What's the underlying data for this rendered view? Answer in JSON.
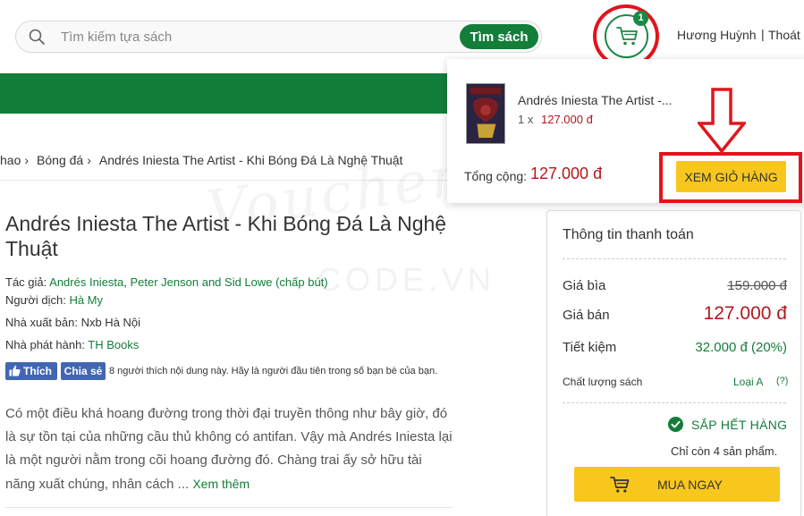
{
  "header": {
    "search_placeholder": "Tìm kiếm tựa sách",
    "search_button": "Tìm sách",
    "cart_count": "1",
    "user_name": "Hương Huỳnh",
    "separator": "|",
    "logout": "Thoát"
  },
  "breadcrumb": [
    {
      "label": "hao"
    },
    {
      "label": "Bóng đá"
    },
    {
      "label": "Andrés Iniesta The Artist - Khi Bóng Đá Là Nghệ Thuật"
    }
  ],
  "breadcrumb_separator": "›",
  "book": {
    "title": "Andrés Iniesta The Artist - Khi Bóng Đá Là Nghệ Thuật",
    "author_label": "Tác giả:",
    "author_1": "Andrés Iniesta",
    "author_2": "Peter Jenson and Sid Lowe (chấp bút)",
    "translator_label": "Người dịch:",
    "translator": "Hà My",
    "publisher_label": "Nhà xuất bản:",
    "publisher": "Nxb Hà Nội",
    "distributor_label": "Nhà phát hành:",
    "distributor": "TH Books",
    "description": "Có một điều khá hoang đường trong thời đại truyền thông như bây giờ, đó là sự tồn tại của những cầu thủ không có antifan. Vậy mà Andrés Iniesta lại là một người nằm trong cõi hoang đường đó. Chàng trai ấy sở hữu tài năng xuất chúng, nhân cách ...",
    "read_more": "Xem thêm"
  },
  "facebook": {
    "like_label": "Thích",
    "share_label": "Chia sẻ",
    "like_text": "8 người thích nội dung này. Hãy là người đầu tiên trong số bạn bè của bạn."
  },
  "cart_dropdown": {
    "item_title": "Andrés Iniesta The Artist -...",
    "item_qty": "1 x",
    "item_price": "127.000 đ",
    "total_label": "Tổng cộng:",
    "total_value": "127.000 đ",
    "view_cart": "XEM GIỎ HÀNG"
  },
  "payment": {
    "title": "Thông tin thanh toán",
    "cover_label": "Giá bìa",
    "cover_price": "159.000 đ",
    "sale_label": "Giá bán",
    "sale_price": "127.000 đ",
    "saving_label": "Tiết kiệm",
    "saving_value": "32.000 đ (20%)",
    "quality_label": "Chất lượng sách",
    "quality_value": "Loại A",
    "quality_help": "(?)",
    "stock_status": "SẮP HẾT HÀNG",
    "stock_remaining": "Chỉ còn 4 sản phẩm.",
    "buy_button": "MUA NGAY"
  },
  "watermark": {
    "brand": "Voucher",
    "code": "CODE.VN"
  },
  "colors": {
    "brand_green": "#137d3a",
    "price_red": "#b3171c",
    "button_yellow": "#f8c71e",
    "annotation_red": "#e3141b"
  }
}
